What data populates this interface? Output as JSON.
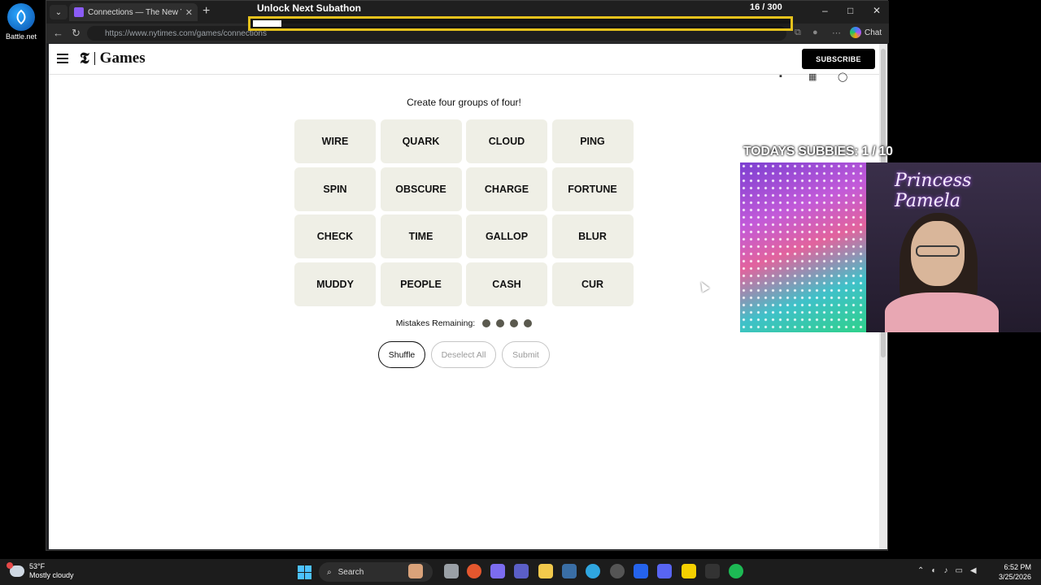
{
  "desktop": {
    "icon_label": "Battle.net"
  },
  "browser": {
    "tab_title": "Connections — The New York Times",
    "url": "https://www.nytimes.com/games/connections",
    "chat_label": "Chat"
  },
  "overlay": {
    "subathon_title": "Unlock Next Subathon",
    "subathon_count": "16 / 300",
    "subathon_progress": 0.053,
    "subbies": "TODAYS SUBBIES:  1 / 10",
    "cam_name": "Princess Pamela"
  },
  "nyt": {
    "logo_text": "Games",
    "subscribe_label": "SUBSCRIBE",
    "prompt": "Create four groups of four!",
    "tiles": [
      "WIRE",
      "QUARK",
      "CLOUD",
      "PING",
      "SPIN",
      "OBSCURE",
      "CHARGE",
      "FORTUNE",
      "CHECK",
      "TIME",
      "GALLOP",
      "BLUR",
      "MUDDY",
      "PEOPLE",
      "CASH",
      "CUR"
    ],
    "mistakes_label": "Mistakes Remaining:",
    "mistakes_remaining": 4,
    "buttons": {
      "shuffle": "Shuffle",
      "deselect": "Deselect All",
      "submit": "Submit"
    }
  },
  "taskbar": {
    "temp": "53°F",
    "weather": "Mostly cloudy",
    "search_label": "Search",
    "time": "6:52 PM",
    "date": "3/25/2026"
  },
  "colors": {
    "tile_bg": "#efefe6",
    "dot": "#5a594e",
    "accent_bar": "#e5c21c"
  }
}
